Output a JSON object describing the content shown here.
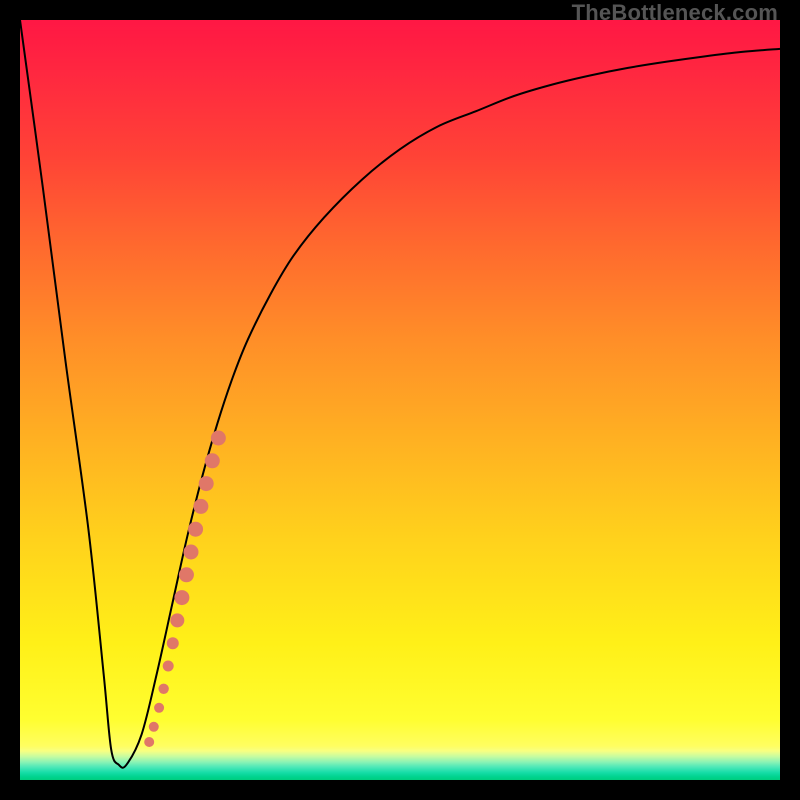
{
  "watermark": "TheBottleneck.com",
  "chart_data": {
    "type": "line",
    "title": "",
    "xlabel": "",
    "ylabel": "",
    "xlim": [
      0,
      100
    ],
    "ylim": [
      0,
      100
    ],
    "grid": false,
    "legend": false,
    "annotations": [],
    "series": [
      {
        "name": "bottleneck-curve",
        "x": [
          0,
          3,
          6,
          9,
          11,
          12,
          13,
          14,
          16,
          18,
          20,
          22,
          24,
          26,
          28,
          30,
          33,
          36,
          40,
          45,
          50,
          55,
          60,
          65,
          70,
          75,
          80,
          85,
          90,
          95,
          100
        ],
        "y": [
          100,
          78,
          55,
          33,
          14,
          4,
          2,
          2,
          6,
          14,
          23,
          32,
          40,
          47,
          53,
          58,
          64,
          69,
          74,
          79,
          83,
          86,
          88,
          90,
          91.5,
          92.7,
          93.7,
          94.5,
          95.2,
          95.8,
          96.2
        ]
      },
      {
        "name": "highlighted-points",
        "x": [
          17.0,
          17.6,
          18.3,
          18.9,
          19.5,
          20.1,
          20.7,
          21.3,
          21.9,
          22.5,
          23.1,
          23.8,
          24.5,
          25.3,
          26.1
        ],
        "y": [
          5.0,
          7.0,
          9.5,
          12.0,
          15.0,
          18.0,
          21.0,
          24.0,
          27.0,
          30.0,
          33.0,
          36.0,
          39.0,
          42.0,
          45.0
        ],
        "r": [
          5.0,
          5.0,
          5.0,
          5.2,
          5.5,
          6.0,
          7.0,
          7.5,
          7.5,
          7.5,
          7.5,
          7.5,
          7.5,
          7.5,
          7.5
        ]
      }
    ]
  }
}
